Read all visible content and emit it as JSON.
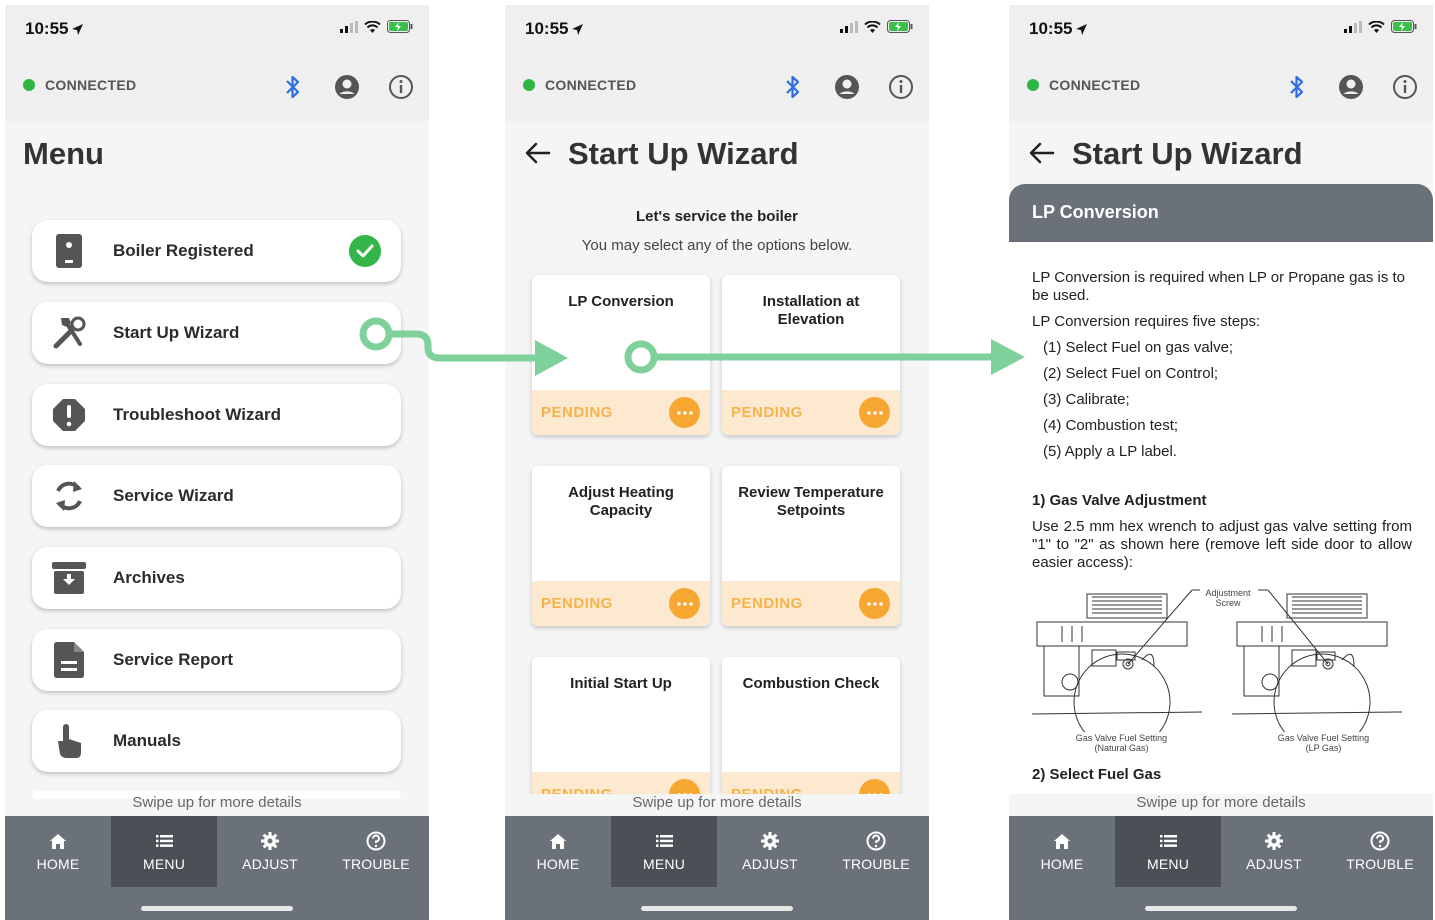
{
  "status": {
    "time": "10:55"
  },
  "connection": {
    "label": "CONNECTED"
  },
  "colors": {
    "connected": "#2fb544",
    "bluetooth": "#2f6fe0",
    "accent_green": "#7ed19a",
    "pending": "#f5b34a",
    "nav_bg": "#6b7178"
  },
  "menu_screen": {
    "title": "Menu",
    "items": [
      {
        "label": "Boiler Registered",
        "icon": "boiler-icon",
        "checked": true
      },
      {
        "label": "Start Up Wizard",
        "icon": "tools-icon"
      },
      {
        "label": "Troubleshoot Wizard",
        "icon": "alert-icon"
      },
      {
        "label": "Service Wizard",
        "icon": "refresh-icon"
      },
      {
        "label": "Archives",
        "icon": "archive-icon"
      },
      {
        "label": "Service Report",
        "icon": "document-icon"
      },
      {
        "label": "Manuals",
        "icon": "hand-icon"
      }
    ]
  },
  "wizard_screen": {
    "title": "Start Up Wizard",
    "intro_bold": "Let's service the boiler",
    "intro": "You may select any of the options below.",
    "cards": [
      {
        "title": "LP Conversion",
        "status": "PENDING"
      },
      {
        "title": "Installation at Elevation",
        "status": "PENDING"
      },
      {
        "title": "Adjust Heating Capacity",
        "status": "PENDING"
      },
      {
        "title": "Review Temperature Setpoints",
        "status": "PENDING"
      },
      {
        "title": "Initial Start Up",
        "status": "PENDING"
      },
      {
        "title": "Combustion Check",
        "status": "PENDING"
      }
    ]
  },
  "lp_screen": {
    "title": "Start Up Wizard",
    "section": "LP Conversion",
    "p1": "LP Conversion is required when LP or Propane gas is to be used.",
    "p2": "LP Conversion requires five steps:",
    "steps": [
      "(1) Select Fuel on gas valve;",
      "(2) Select Fuel on Control;",
      "(3) Calibrate;",
      "(4) Combustion test;",
      "(5) Apply a LP label."
    ],
    "h1": "1) Gas Valve Adjustment",
    "p3": "Use 2.5 mm hex wrench to adjust gas valve setting from \"1\" to \"2\" as shown here (remove left side door to allow easier access):",
    "diagram": {
      "adjust_label_1": "Adjustment",
      "adjust_label_2": "Screw",
      "left_caption_1": "Gas Valve Fuel Setting",
      "left_caption_2": "(Natural Gas)",
      "right_caption_1": "Gas Valve Fuel Setting",
      "right_caption_2": "(LP Gas)"
    },
    "h2": "2) Select Fuel Gas"
  },
  "swipe_hint": "Swipe up for more details",
  "nav": {
    "home": "HOME",
    "menu": "MENU",
    "adjust": "ADJUST",
    "trouble": "TROUBLE"
  }
}
